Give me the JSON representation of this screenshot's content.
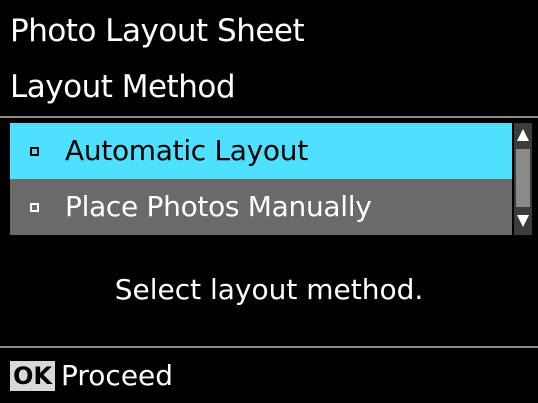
{
  "header": {
    "title": "Photo Layout Sheet",
    "subtitle": "Layout Method"
  },
  "list": {
    "items": [
      {
        "label": "Automatic Layout",
        "selected": true
      },
      {
        "label": "Place Photos Manually",
        "selected": false
      }
    ]
  },
  "message": "Select layout method.",
  "footer": {
    "ok_label": "OK",
    "action_label": "Proceed"
  },
  "colors": {
    "background": "#000000",
    "selection": "#4fe0ff",
    "unselected_row": "#6a6a6a",
    "divider": "#8a8a8a"
  },
  "icons": {
    "scroll_up": "triangle-up-icon",
    "scroll_down": "triangle-down-icon",
    "bullet": "square-bullet-icon"
  }
}
